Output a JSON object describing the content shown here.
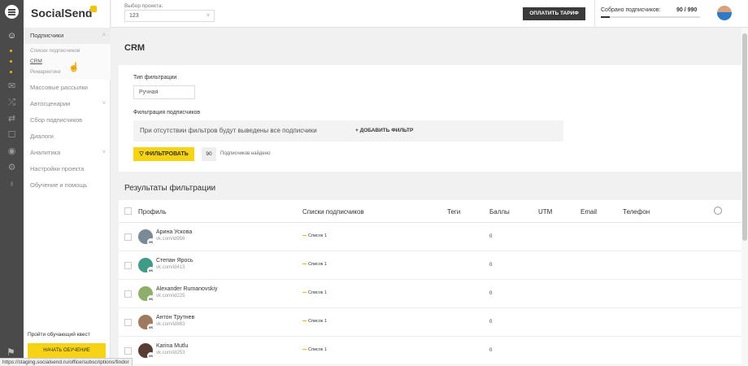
{
  "app": {
    "logo": "SocialSend"
  },
  "sidebar": {
    "items": [
      {
        "label": "Подписчики",
        "open": true,
        "chevron": "˄"
      },
      {
        "label": "Массовые рассылки"
      },
      {
        "label": "Автосценарии",
        "chevron": "˅"
      },
      {
        "label": "Сбор подписчиков"
      },
      {
        "label": "Диалоги"
      },
      {
        "label": "Аналитика",
        "chevron": "˅"
      },
      {
        "label": "Настройки проекта"
      },
      {
        "label": "Обучение и помощь"
      }
    ],
    "subitems": [
      {
        "label": "Списки подписчиков"
      },
      {
        "label": "CRM",
        "current": true
      },
      {
        "label": "Ремаркетинг"
      }
    ],
    "quest_title": "Пройти обучающий квест",
    "quest_button": "НАЧАТЬ ОБУЧЕНИЕ"
  },
  "topbar": {
    "project_label": "Выбор проекта:",
    "project_value": "123",
    "pay_button": "ОПЛАТИТЬ ТАРИФ",
    "subs_label": "Собрано подписчиков:",
    "subs_count": "90 / 990",
    "subs_progress": 0.09
  },
  "main": {
    "title": "CRM",
    "filter": {
      "type_label": "Тип фильтрации",
      "type_value": "Ручная",
      "subs_label": "Фильтрация подписчиков",
      "hint": "При отсутствии фильтров будут выведены все подписчики",
      "add_label": "+ ДОБАВИТЬ ФИЛЬТР",
      "button": "ФИЛЬТРОВАТЬ",
      "count": "90",
      "count_text": "Подписчиков найдено"
    },
    "results_title": "Результаты фильтрации",
    "columns": [
      "Профиль",
      "Списки подписчиков",
      "Теги",
      "Баллы",
      "UTM",
      "Email",
      "Телефон"
    ],
    "rows": [
      {
        "name": "Арина Ускова",
        "link": "vk.com/id956",
        "list": "Список 1",
        "score": "0",
        "avatar_color": "#7a8a96"
      },
      {
        "name": "Степан Ярось",
        "link": "vk.com/id413",
        "list": "Список 1",
        "score": "0",
        "avatar_color": "#3f9a86"
      },
      {
        "name": "Alexander Rumanovskiy",
        "link": "vk.com/id225",
        "list": "Список 1",
        "score": "0",
        "avatar_color": "#8fae6a"
      },
      {
        "name": "Антон Трутнев",
        "link": "vk.com/id883",
        "list": "Список 1",
        "score": "0",
        "avatar_color": "#a07a5e"
      },
      {
        "name": "Karina Mutlu",
        "link": "vk.com/id253",
        "list": "Список 1",
        "score": "0",
        "avatar_color": "#5a3d32"
      }
    ],
    "vk_badge": "VK"
  },
  "status_url": "https://staging.socialsend.ru/office/subscriptions/findor",
  "colors": {
    "accent": "#f7d316",
    "dark": "#3a3a3a",
    "rail": "#4a4a4a"
  }
}
